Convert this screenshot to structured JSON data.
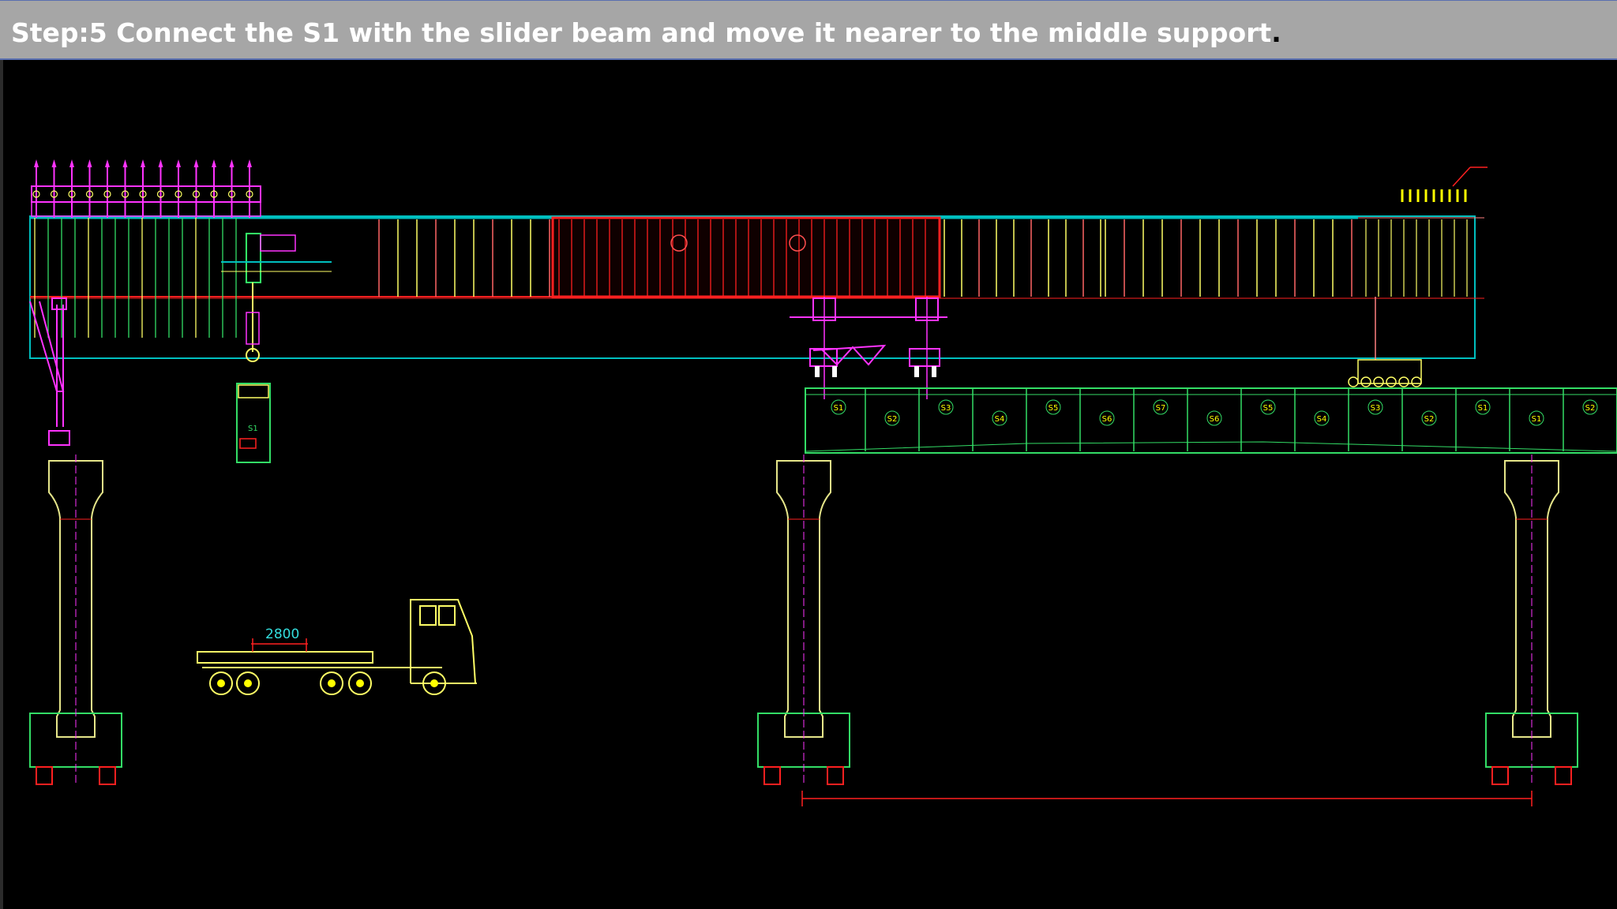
{
  "title": {
    "text": "Step:5 Connect the S1 with the slider beam and move it nearer to the middle support",
    "end_mark": "."
  },
  "drawing": {
    "dimension_label": "2800",
    "hanging_segment_label": "S1",
    "girder_segment_labels": [
      "S1",
      "S2",
      "S3",
      "S4",
      "S5",
      "S6",
      "S7",
      "S6",
      "S5",
      "S4",
      "S3",
      "S2",
      "S1",
      "S1",
      "S2"
    ],
    "colors": {
      "background": "#000000",
      "title_bar": "#a6a6a6",
      "beam_outline": "#00bfbf",
      "beam_core": "#ff2020",
      "vertical_members": "#ffff66",
      "piers": "#e6e68a",
      "girder_segments": "#33dd66",
      "supports": "#ff33ff",
      "segment_marks": "#ffff00"
    }
  }
}
